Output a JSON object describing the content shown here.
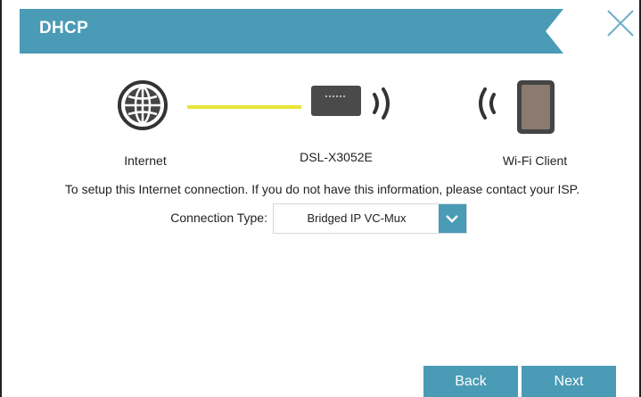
{
  "dialog": {
    "title": "DHCP",
    "accent_color": "#4a9bb5"
  },
  "diagram": {
    "internet_label": "Internet",
    "device_label": "DSL-X3052E",
    "client_label": "Wi-Fi Client",
    "link_color": "#e8e53a"
  },
  "intro_text": "To setup this Internet connection. If you do not have this information, please contact your ISP.",
  "connection_type": {
    "label": "Connection Type:",
    "selected": "Bridged IP VC-Mux"
  },
  "buttons": {
    "back": "Back",
    "next": "Next"
  },
  "icons": [
    "globe-icon",
    "router-icon",
    "wifi-signal-icon",
    "tablet-icon",
    "close-icon",
    "chevron-down-icon"
  ]
}
